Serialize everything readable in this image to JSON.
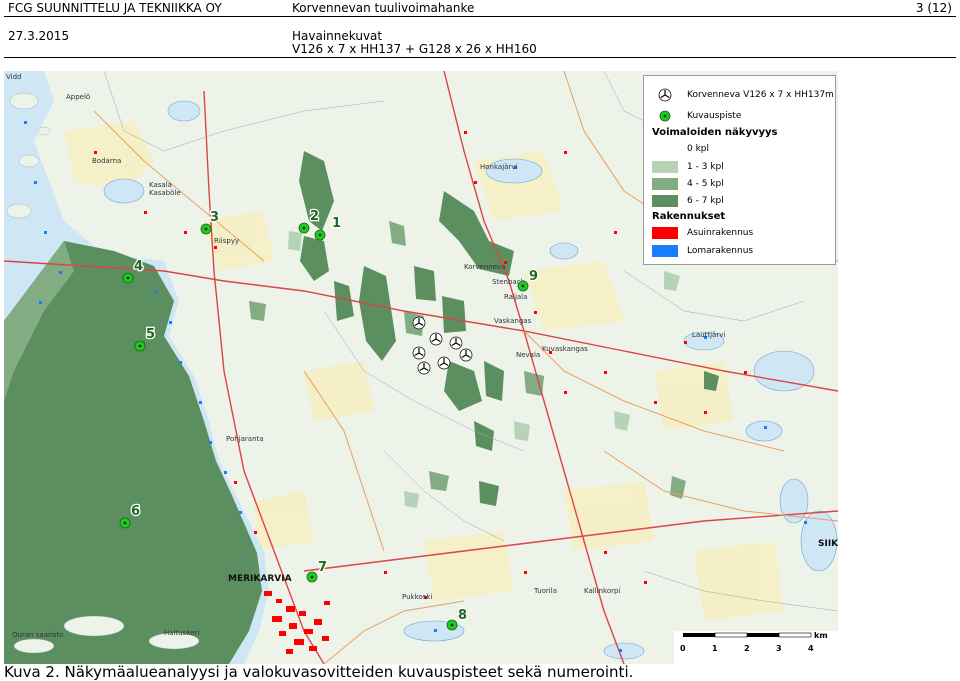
{
  "header": {
    "company": "FCG SUUNNITTELU JA TEKNIIKKA OY",
    "date": "27.3.2015",
    "project": "Korvennevan tuulivoimahanke",
    "section": "Havainnekuvat",
    "configuration": "V126 x 7 x HH137 + G128 x 26 x HH160",
    "page": "3 (12)"
  },
  "legend": {
    "turbine_label": "Korvenneva V126 x 7 x HH137m",
    "viewpoint_label": "Kuvauspiste",
    "visibility_title": "Voimaloiden näkyvyys",
    "visibility_classes": [
      {
        "label": "0 kpl",
        "color": "#ffffff"
      },
      {
        "label": "1 - 3 kpl",
        "color": "#b7d3b7"
      },
      {
        "label": "4 - 5 kpl",
        "color": "#82ad82"
      },
      {
        "label": "6 - 7 kpl",
        "color": "#5c8f5f"
      }
    ],
    "buildings_title": "Rakennukset",
    "building_classes": [
      {
        "label": "Asuinrakennus",
        "color": "#ff0000"
      },
      {
        "label": "Lomarakennus",
        "color": "#1a7cff"
      }
    ]
  },
  "viewpoints": [
    "1",
    "2",
    "3",
    "4",
    "5",
    "6",
    "7",
    "8",
    "9"
  ],
  "scalebar": {
    "unit": "km",
    "ticks": [
      "0",
      "1",
      "2",
      "3",
      "4"
    ]
  },
  "map_labels": {
    "appelo": "Appelö",
    "bodarna": "Bodarna",
    "kasala": "Kasala",
    "kasabole": "Kasaböle",
    "riispyy": "Riispyy",
    "ohkanjarvi": "Honkajärvi",
    "korvenneva": "Korvenneva",
    "vaskangas": "Vaskangas",
    "kuvaskangas": "Kuvaskangas",
    "lauttjarvi": "Lauttjärvi",
    "merikarvia": "MERIKARVIA",
    "pohjaranta": "Pohjaranta",
    "pukkoski": "Pukkoski",
    "tuorila": "Tuorila",
    "kallinkorpi": "Kallinkorpi",
    "ouran": "Ouran saaristo",
    "haltuskeri": "Haltuskeri",
    "siik": "SIIK",
    "stenback": "Stenback",
    "raijala": "Raijala",
    "nevala": "Nevala",
    "vidd": "Vidd"
  },
  "caption": "Kuva 2. Näkymäalueanalyysi ja valokuvasovitteiden kuvauspisteet sekä numerointi.",
  "colors": {
    "sea": "#3d8a5a",
    "land": "#eef3ea",
    "visibility_dark": "#5c8f5f"
  }
}
